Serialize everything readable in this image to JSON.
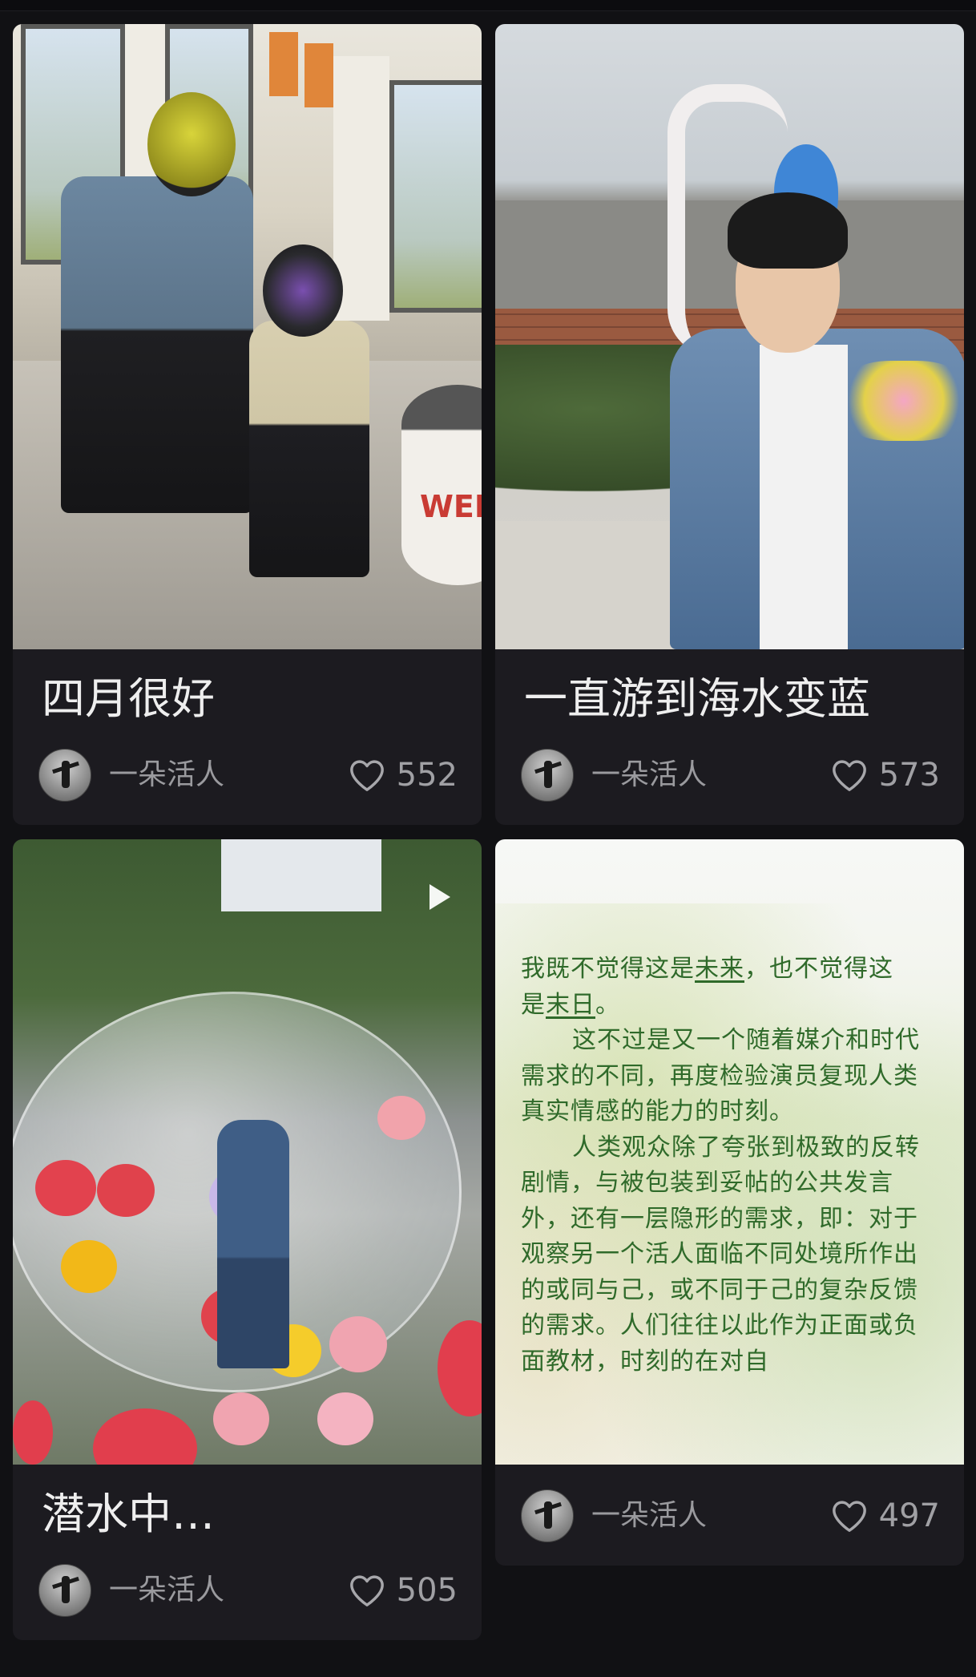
{
  "cards": [
    {
      "title": "四月很好",
      "author": "一朵活人",
      "likes": "552",
      "image_text": [
        "WEL"
      ]
    },
    {
      "title": "一直游到海水变蓝",
      "author": "一朵活人",
      "likes": "573"
    },
    {
      "title": "潜水中…",
      "author": "一朵活人",
      "likes": "505",
      "is_video": true
    },
    {
      "author": "一朵活人",
      "likes": "497",
      "text_image": {
        "line1_a": "我既不觉得这是",
        "line1_u": "未来",
        "line1_b": "，也不觉得这",
        "line2_a": "是",
        "line2_u": "末日",
        "line2_b": "。",
        "para2": "这不过是又一个随着媒介和时代需求的不同，再度检验演员复现人类真实情感的能力的时刻。",
        "para3": "人类观众除了夸张到极致的反转剧情，与被包装到妥帖的公共发言外，还有一层隐形的需求，即：对于观察另一个活人面临不同处境所作出的或同与己，或不同于己的复杂反馈的需求。人们往往以此作为正面或负面教材，时刻的在对自"
      }
    }
  ],
  "colors": {
    "background": "#111114",
    "card": "#1c1b20",
    "title": "#eeeeee",
    "meta": "#9a9a9e",
    "poem_text": "#2f6a2a"
  },
  "icons": {
    "like": "heart-outline-icon",
    "video": "play-icon"
  }
}
